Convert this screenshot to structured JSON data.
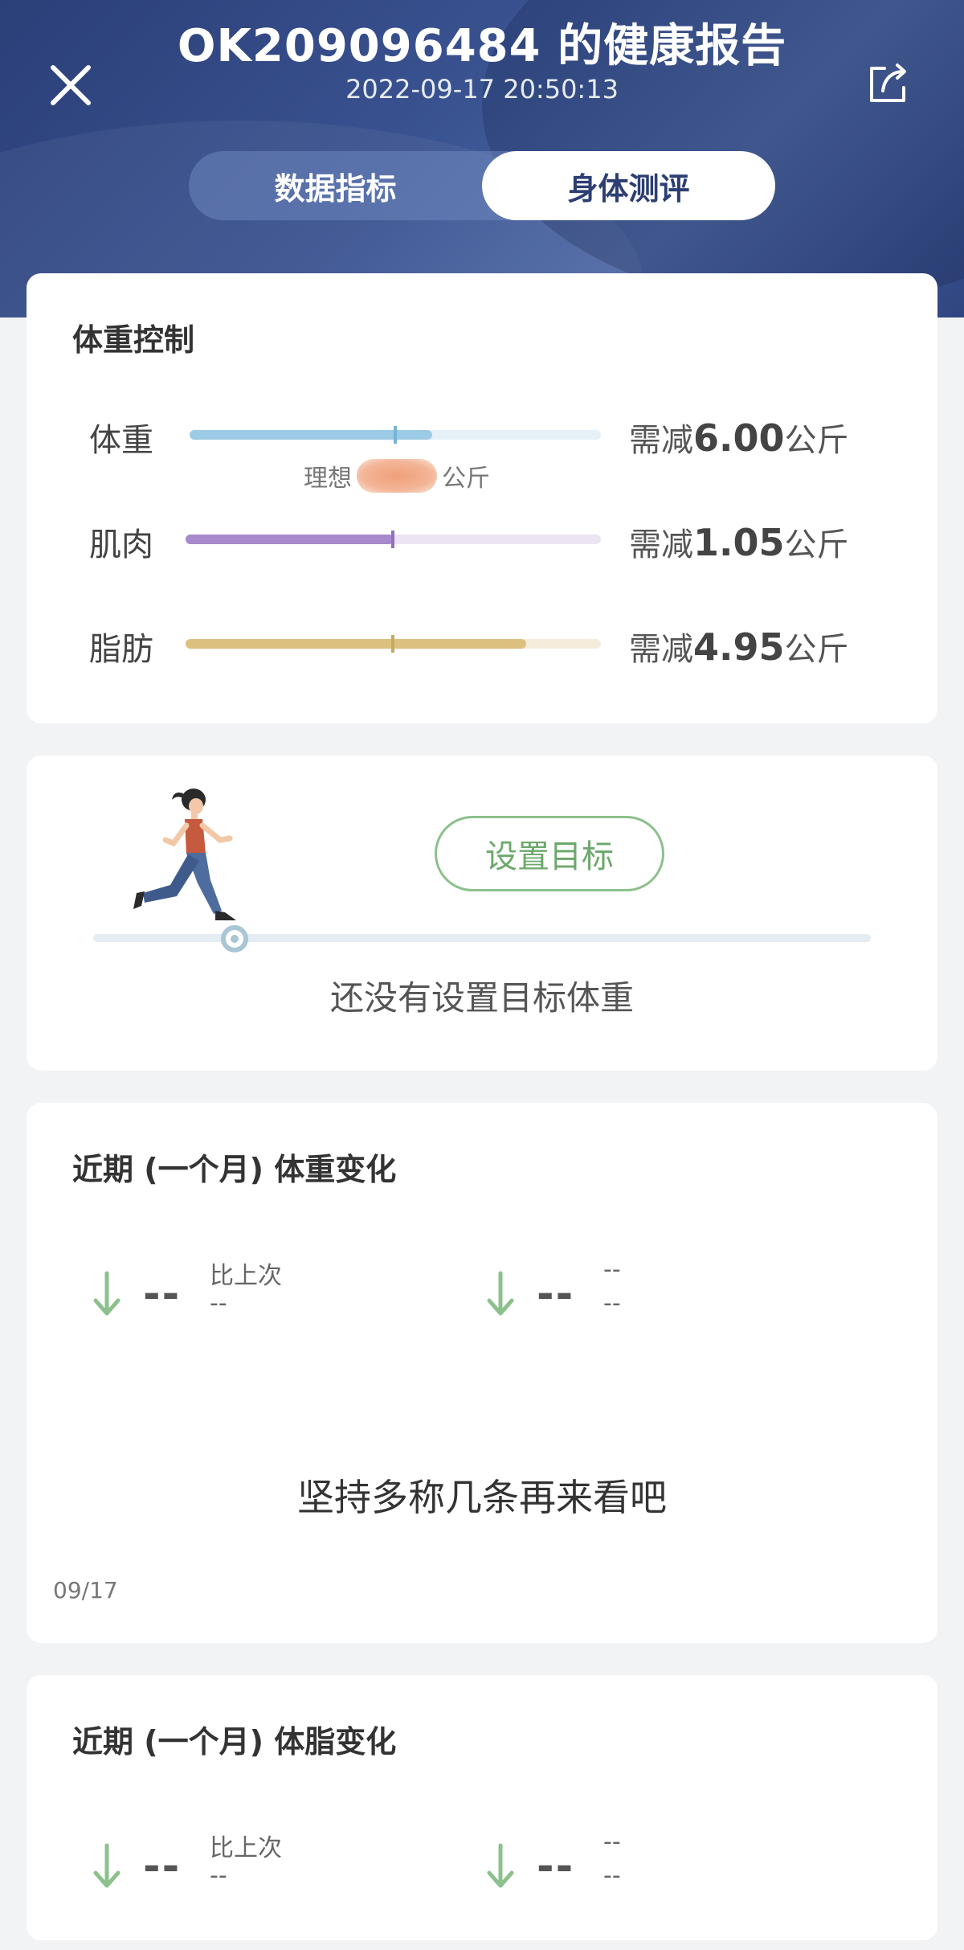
{
  "header": {
    "title": "OK209096484 的健康报告",
    "timestamp": "2022-09-17 20:50:13",
    "tabs": [
      {
        "label": "数据指标",
        "active": false
      },
      {
        "label": "身体测评",
        "active": true
      }
    ]
  },
  "weight_control": {
    "title": "体重控制",
    "rows": [
      {
        "label": "体重",
        "prefix": "需减",
        "value": "6.00",
        "unit": "公斤",
        "progress": 0.59,
        "color": "#9ccbe6",
        "track": "#e5f0f7",
        "tick": "#78b3d6"
      },
      {
        "label": "肌肉",
        "prefix": "需减",
        "value": "1.05",
        "unit": "公斤",
        "progress": 0.5,
        "color": "#a889cc",
        "track": "#ece4f3",
        "tick": "#9170c0"
      },
      {
        "label": "脂肪",
        "prefix": "需减",
        "value": "4.95",
        "unit": "公斤",
        "progress": 0.82,
        "color": "#dcc080",
        "track": "#f5ecdc",
        "tick": "#c9a860"
      }
    ],
    "ideal_prefix": "理想",
    "ideal_unit": "公斤"
  },
  "goal": {
    "button_label": "设置目标",
    "status_text": "还没有设置目标体重"
  },
  "weight_change": {
    "title": "近期 (一个月) 体重变化",
    "stat_left": {
      "value": "--",
      "label1": "比上次",
      "label2": "--"
    },
    "stat_right": {
      "value": "--",
      "label1": "--",
      "label2": "--"
    },
    "message": "坚持多称几条再来看吧",
    "date": "09/17"
  },
  "fat_change": {
    "title": "近期 (一个月) 体脂变化",
    "stat_left": {
      "value": "--",
      "label1": "比上次",
      "label2": "--"
    },
    "stat_right": {
      "value": "--",
      "label1": "--",
      "label2": "--"
    }
  }
}
